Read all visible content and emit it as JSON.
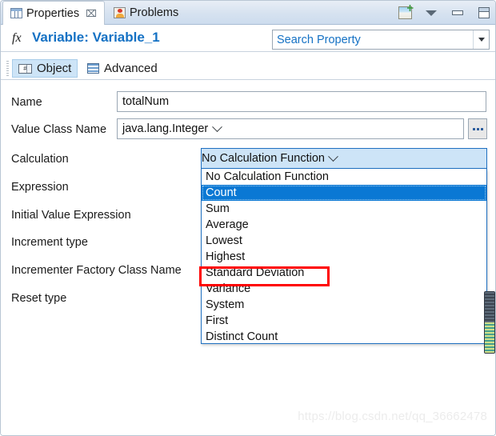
{
  "window": {
    "tabs": [
      {
        "label": "Properties",
        "icon": "table-icon",
        "active": true,
        "closable": true,
        "close_glyph": "⌧"
      },
      {
        "label": "Problems",
        "icon": "problems-icon",
        "active": false,
        "closable": false
      }
    ],
    "toolbar": [
      {
        "name": "new-properties-view-icon"
      },
      {
        "name": "view-menu-chevron-down-icon"
      },
      {
        "name": "minimize-icon"
      },
      {
        "name": "maximize-icon"
      }
    ]
  },
  "title_bar": {
    "fx_glyph": "fx",
    "title": "Variable: Variable_1",
    "title_color": "#1471c4"
  },
  "search": {
    "placeholder": "Search Property",
    "value": "Search Property",
    "text_color": "#1471c4"
  },
  "sub_tabs": [
    {
      "label": "Object",
      "icon": "object-icon",
      "selected": true
    },
    {
      "label": "Advanced",
      "icon": "advanced-icon",
      "selected": false
    }
  ],
  "form": {
    "labels": {
      "name": "Name",
      "value_class_name": "Value Class Name",
      "calculation": "Calculation",
      "expression": "Expression",
      "initial_value_expression": "Initial Value Expression",
      "increment_type": "Increment type",
      "incrementer_factory_class_name": "Incrementer Factory Class Name",
      "reset_type": "Reset type"
    },
    "values": {
      "name": "totalNum",
      "value_class_name": "java.lang.Integer",
      "calculation_selected": "No Calculation Function"
    },
    "browse_button_label": "..."
  },
  "calculation_dropdown": {
    "open": true,
    "selected": "No Calculation Function",
    "highlighted": "Count",
    "highlight_color": "#0a78d4",
    "border_color": "#1e6fc0",
    "head_background": "#cde4f7",
    "options": [
      "No Calculation Function",
      "Count",
      "Sum",
      "Average",
      "Lowest",
      "Highest",
      "Standard Deviation",
      "Variance",
      "System",
      "First",
      "Distinct Count"
    ]
  },
  "annotation": {
    "shape": "rectangle",
    "color": "#ff0000",
    "target": "Count"
  },
  "watermark": {
    "text": "https://blog.csdn.net/qq_36662478"
  }
}
